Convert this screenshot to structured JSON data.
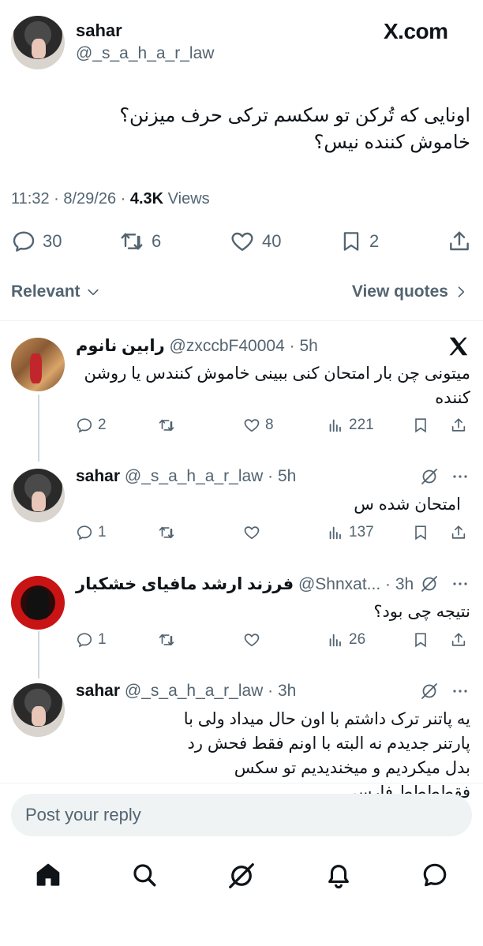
{
  "main_post": {
    "name": "sahar",
    "handle": "@_s_a_h_a_r_law",
    "brand": "X.com",
    "text_line1": "اونایی که تُرکن تو سکسم ترکی حرف میزنن؟",
    "text_line2": "خاموش کننده نیس؟",
    "time": "11:32 · 8/29/26 ·",
    "views_count": "4.3K",
    "views_label": "Views",
    "replies": "30",
    "reposts": "6",
    "likes": "40",
    "bookmarks": "2"
  },
  "filter": {
    "relevant_label": "Relevant",
    "view_quotes_label": "View quotes"
  },
  "replies": [
    {
      "name": "رابین نانوم",
      "handle": "@zxccbF40004",
      "time": "· 5h",
      "text": "میتونی چن بار امتحان کنی ببینی خاموش کنندس یا روشن کننده",
      "replies": "2",
      "likes": "8",
      "views": "221"
    },
    {
      "name": "sahar",
      "handle": "@_s_a_h_a_r_law",
      "time": "· 5h",
      "text": "امتحان شده س",
      "replies": "1",
      "likes": "",
      "views": "137"
    },
    {
      "name": "فرزند ارشد مافیای خشکبار",
      "handle": "@Shnxat...",
      "time": "· 3h",
      "text": "نتیجه چی بود؟",
      "replies": "1",
      "likes": "",
      "views": "26"
    },
    {
      "name": "sahar",
      "handle": "@_s_a_h_a_r_law",
      "time": "· 3h",
      "text": "یه پاتنر ترک داشتم با اون حال میداد ولی با پارتنر جدیدم نه البته با اونم فقط فحش رد بدل میکردیم و میخندیدیم تو سکس فقطططط فارسی",
      "replies": "",
      "likes": "",
      "views": ""
    }
  ],
  "composer": {
    "placeholder": "Post your reply"
  },
  "nav": {
    "items": [
      "home-icon",
      "search-icon",
      "grok-icon",
      "notifications-icon",
      "messages-icon"
    ]
  }
}
